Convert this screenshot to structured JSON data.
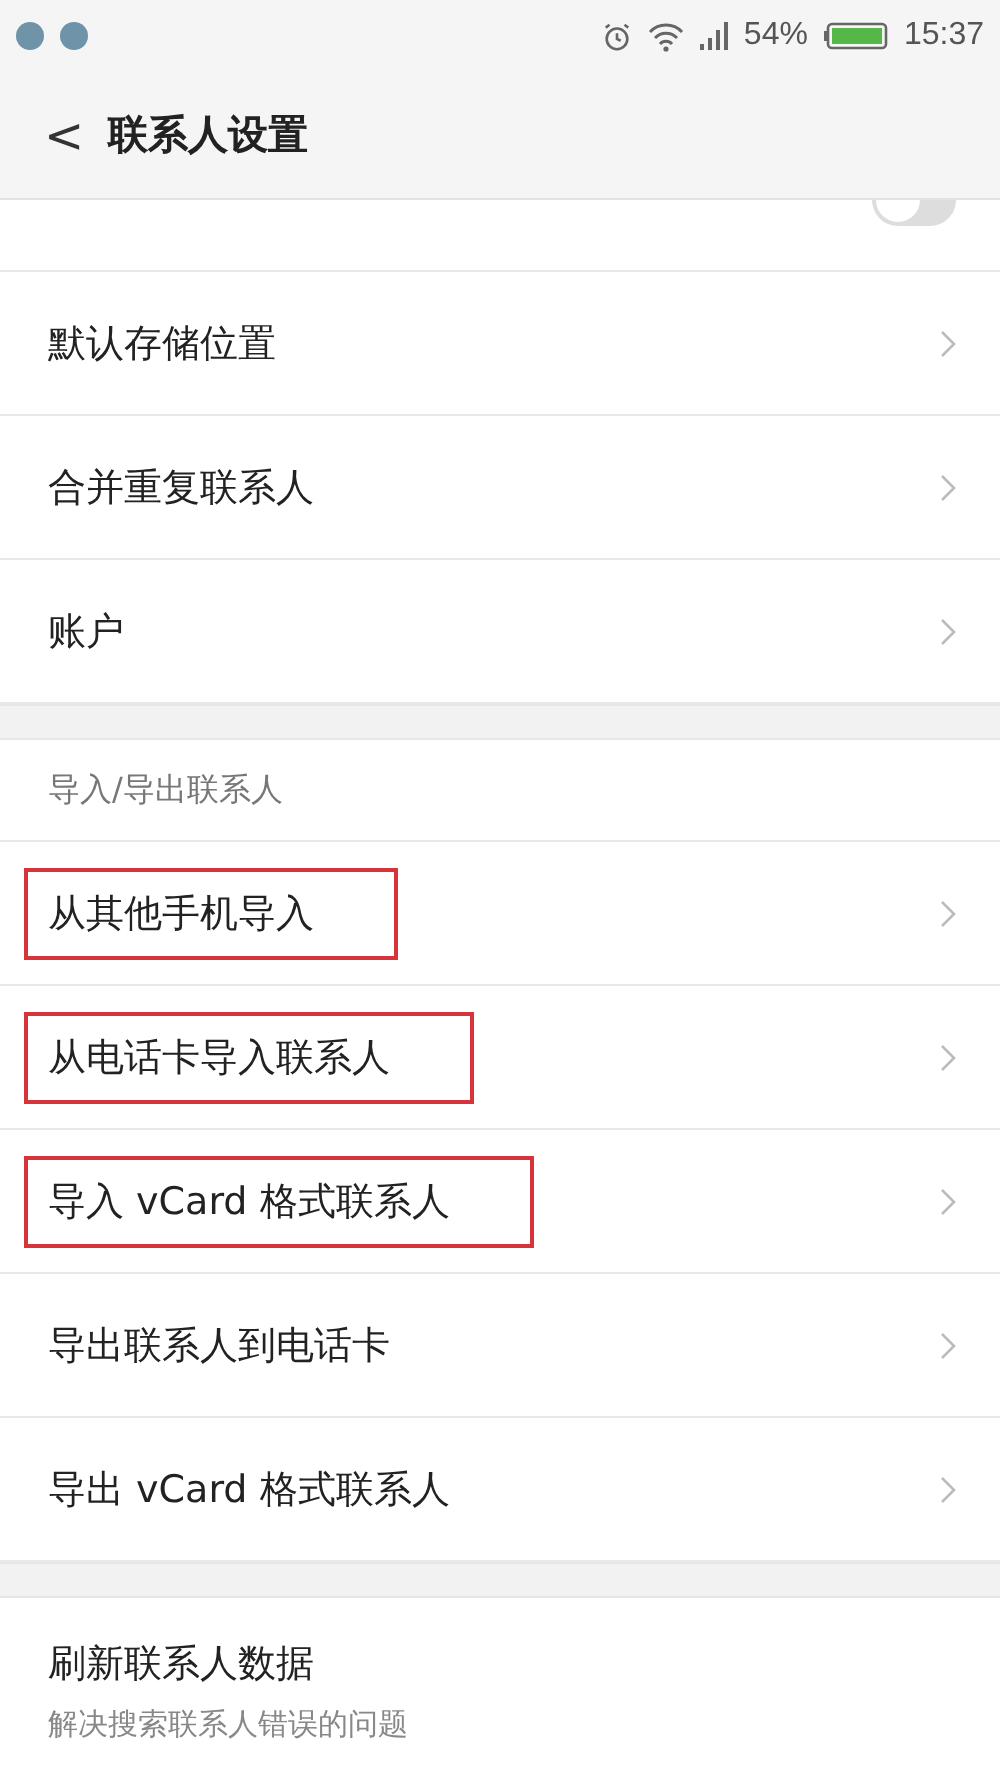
{
  "status_bar": {
    "battery_text": "54%",
    "time": "15:37"
  },
  "header": {
    "back": "<",
    "title": "联系人设置"
  },
  "sections": [
    {
      "items": [
        {
          "kind": "toggle",
          "on": false
        },
        {
          "kind": "link",
          "label": "默认存储位置",
          "highlighted": false
        },
        {
          "kind": "link",
          "label": "合并重复联系人",
          "highlighted": false
        },
        {
          "kind": "link",
          "label": "账户",
          "highlighted": false
        }
      ]
    },
    {
      "header": "导入/导出联系人",
      "items": [
        {
          "kind": "link",
          "label": "从其他手机导入",
          "highlighted": true
        },
        {
          "kind": "link",
          "label": "从电话卡导入联系人",
          "highlighted": true
        },
        {
          "kind": "link",
          "label": "导入 vCard 格式联系人",
          "highlighted": true
        },
        {
          "kind": "link",
          "label": "导出联系人到电话卡",
          "highlighted": false
        },
        {
          "kind": "link",
          "label": "导出 vCard 格式联系人",
          "highlighted": false
        }
      ]
    },
    {
      "items": [
        {
          "kind": "detail",
          "label": "刷新联系人数据",
          "subtitle": "解决搜索联系人错误的问题",
          "highlighted": false
        }
      ]
    }
  ]
}
